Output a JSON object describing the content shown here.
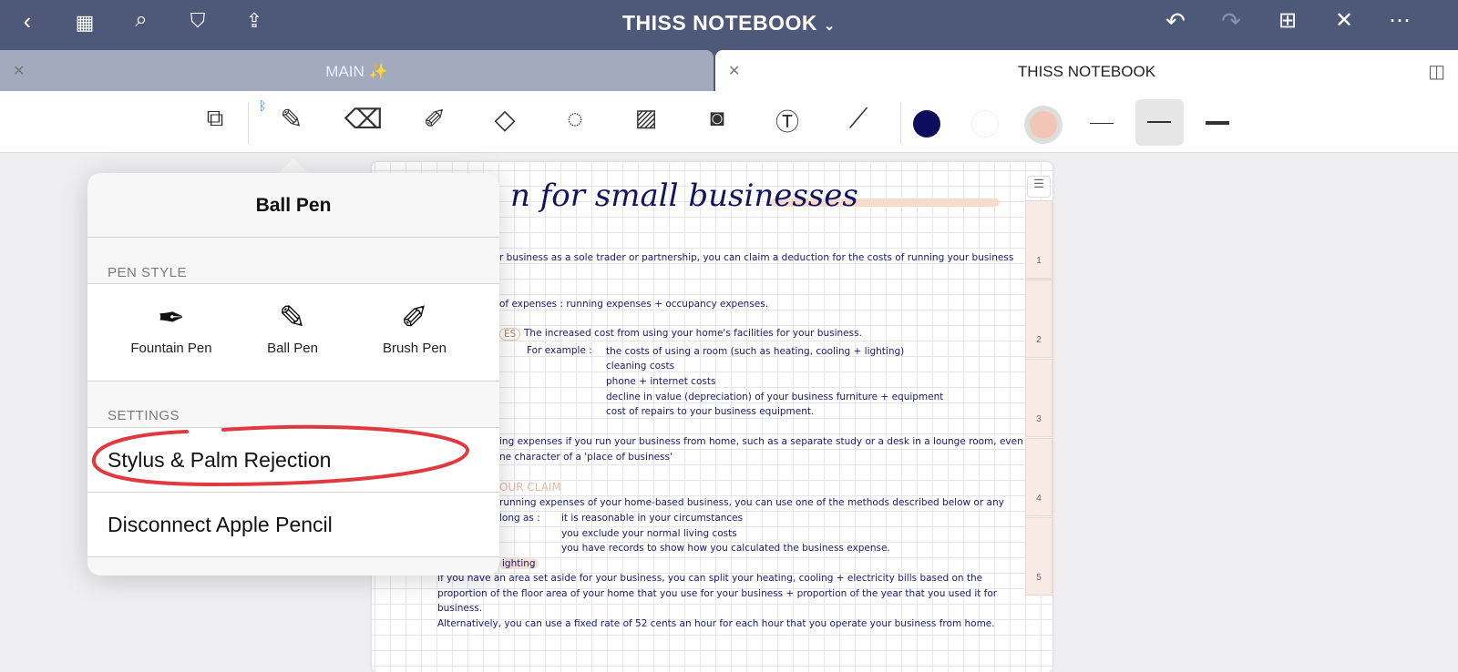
{
  "topbar": {
    "title": "THISS NOTEBOOK",
    "title_chevron": "⌄",
    "left_icons": [
      "back-icon",
      "grid-icon",
      "search-icon",
      "bookmark-icon",
      "share-icon"
    ],
    "right_icons": [
      "undo-icon",
      "redo-icon",
      "add-page-icon",
      "close-edit-icon",
      "more-icon"
    ]
  },
  "tabs": [
    {
      "label": "MAIN ✨",
      "active": false
    },
    {
      "label": "THISS NOTEBOOK",
      "active": true
    }
  ],
  "toolbar": {
    "tools": [
      "read-only-icon",
      "pen-icon",
      "eraser-icon",
      "highlighter-icon",
      "shapes-icon",
      "lasso-icon",
      "image-icon",
      "camera-icon",
      "text-icon",
      "laser-pointer-icon"
    ],
    "colors": [
      "#0d0d5e",
      "#ffffff",
      "#f2c6b6"
    ],
    "stroke_widths": [
      "thin",
      "medium",
      "thick"
    ],
    "selected_width": "medium",
    "bluetooth": "ᛒ"
  },
  "popover": {
    "title": "Ball Pen",
    "pen_style_header": "PEN STYLE",
    "pen_styles": [
      {
        "label": "Fountain Pen"
      },
      {
        "label": "Ball Pen",
        "selected": true
      },
      {
        "label": "Brush Pen"
      }
    ],
    "settings_header": "SETTINGS",
    "settings": [
      "Stylus & Palm Rejection",
      "Disconnect Apple Pencil"
    ],
    "annotation_color": "#e0393e"
  },
  "page": {
    "title": "n for small businesses",
    "lines": [
      "r business as a sole trader or partnership, you can claim a deduction for the costs of running your business",
      "of expenses : running expenses + occupancy expenses.",
      "ES",
      "The increased cost from using your home's facilities for your business.",
      "For example :",
      "the costs of using a room (such as heating, cooling + lighting)",
      "cleaning costs",
      "phone + internet costs",
      "decline in value (depreciation) of your business furniture + equipment",
      "cost of repairs to your business equipment.",
      "ing expenses if you run your business from home, such as a separate study or a desk in a lounge room, even",
      "ne character of a 'place of business'",
      "OUR CLAIM",
      "running expenses of your home-based business, you can use one of the methods described below or any",
      "long as :",
      "it is reasonable in your circumstances",
      "you exclude your normal living costs",
      "you have records to show how you calculated the business expense.",
      "ighting",
      "If you have an area set aside for your business, you can split your heating, cooling + electricity bills based on the",
      "proportion of the floor area of your home that you use for your business + proportion of the year that you used it for",
      "business.",
      "Alternatively, you can use a fixed rate of 52 cents an hour for each hour that you operate your business from home."
    ],
    "page_tabs": [
      "1",
      "2",
      "3",
      "4",
      "5"
    ]
  }
}
